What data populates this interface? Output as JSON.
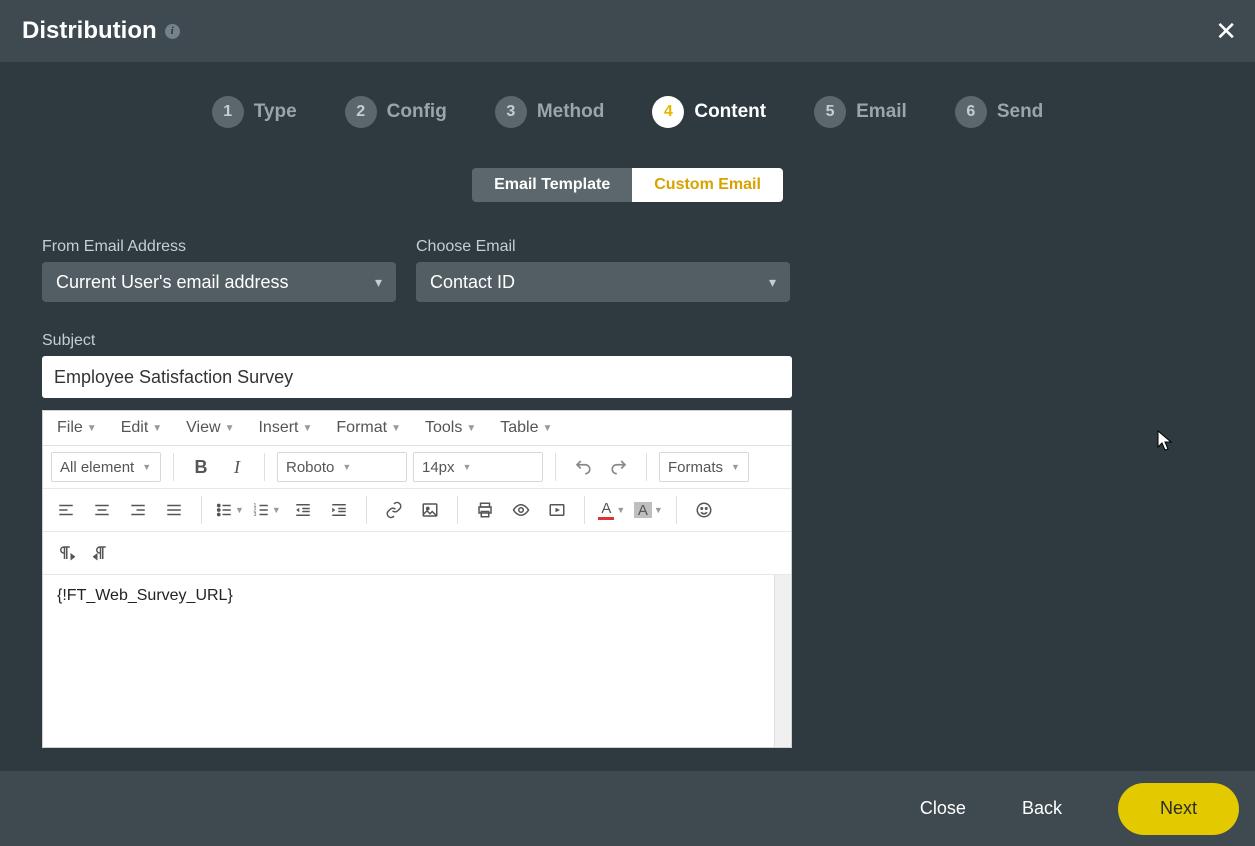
{
  "header": {
    "title": "Distribution"
  },
  "wizard": {
    "steps": [
      {
        "num": "1",
        "label": "Type",
        "active": false
      },
      {
        "num": "2",
        "label": "Config",
        "active": false
      },
      {
        "num": "3",
        "label": "Method",
        "active": false
      },
      {
        "num": "4",
        "label": "Content",
        "active": true
      },
      {
        "num": "5",
        "label": "Email",
        "active": false
      },
      {
        "num": "6",
        "label": "Send",
        "active": false
      }
    ]
  },
  "segment": {
    "email_template": "Email Template",
    "custom_email": "Custom Email",
    "active": "custom_email"
  },
  "fields": {
    "from_label": "From Email Address",
    "from_value": "Current User's email address",
    "choose_label": "Choose Email",
    "choose_value": "Contact ID",
    "subject_label": "Subject",
    "subject_value": "Employee Satisfaction Survey"
  },
  "editor": {
    "menus": [
      "File",
      "Edit",
      "View",
      "Insert",
      "Format",
      "Tools",
      "Table"
    ],
    "tag_dd": "All element",
    "font_dd": "Roboto",
    "size_dd": "14px",
    "formats_dd": "Formats",
    "content": "{!FT_Web_Survey_URL}"
  },
  "footer": {
    "close": "Close",
    "back": "Back",
    "next": "Next"
  }
}
